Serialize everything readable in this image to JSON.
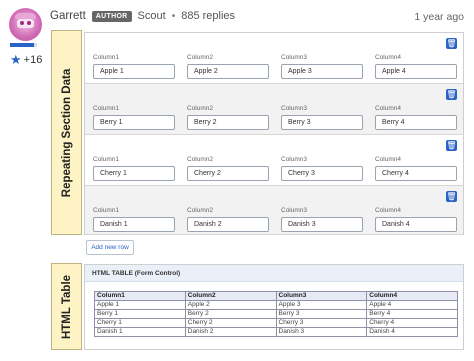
{
  "post": {
    "author": "Garrett",
    "badge": "AUTHOR",
    "rank": "Scout",
    "separator": "•",
    "replies": "885 replies",
    "time": "1 year ago",
    "kudos_count": "+16",
    "rank_progress": 0.9
  },
  "repeating_section": {
    "title": "Repeating Section Data",
    "columns": [
      "Column1",
      "Column2",
      "Column3",
      "Column4"
    ],
    "rows": [
      [
        "Apple 1",
        "Apple 2",
        "Apple 3",
        "Apple 4"
      ],
      [
        "Berry 1",
        "Berry 2",
        "Berry 3",
        "Berry 4"
      ],
      [
        "Cherry 1",
        "Cherry 2",
        "Cherry 3",
        "Cherry 4"
      ],
      [
        "Danish 1",
        "Danish 2",
        "Danish 3",
        "Danish 4"
      ]
    ],
    "delete_icon": "trash-icon",
    "add_row_label": "Add new row"
  },
  "html_table": {
    "title": "HTML Table",
    "header": "HTML TABLE (Form Control)",
    "columns": [
      "Column1",
      "Column2",
      "Column3",
      "Column4"
    ],
    "rows": [
      [
        "Apple 1",
        "Apple 2",
        "Apple 3",
        "Apple 4"
      ],
      [
        "Berry 1",
        "Berry 2",
        "Berry 3",
        "Berry 4"
      ],
      [
        "Cherry 1",
        "Cherry 2",
        "Cherry 3",
        "Cherry 4"
      ],
      [
        "Danish 1",
        "Danish 2",
        "Danish 3",
        "Danish 4"
      ]
    ]
  },
  "colors": {
    "accent": "#2a63c6",
    "tab_background": "#fdf3c4",
    "row_alt": "#f2f2f2"
  }
}
